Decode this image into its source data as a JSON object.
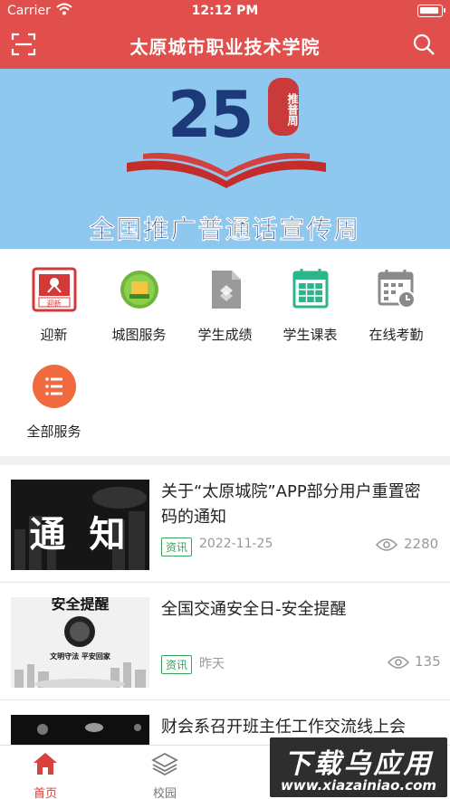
{
  "status_bar": {
    "carrier": "Carrier",
    "time": "12:12 PM"
  },
  "header": {
    "title": "太原城市职业技术学院"
  },
  "banner": {
    "number": "25",
    "seal_text": "推普周",
    "caption": "全国推广普通话宣传周"
  },
  "services": [
    {
      "label": "迎新",
      "icon": "welcome-icon",
      "badge_text": "迎新"
    },
    {
      "label": "城图服务",
      "icon": "library-icon"
    },
    {
      "label": "学生成绩",
      "icon": "grades-icon"
    },
    {
      "label": "学生课表",
      "icon": "timetable-icon"
    },
    {
      "label": "在线考勤",
      "icon": "attendance-icon"
    },
    {
      "label": "全部服务",
      "icon": "list-icon"
    }
  ],
  "news": [
    {
      "title": "关于“太原城院”APP部分用户重置密码的通知",
      "tag": "资讯",
      "date": "2022-11-25",
      "views": "2280",
      "thumb_text": "通 知"
    },
    {
      "title": "全国交通安全日-安全提醒",
      "tag": "资讯",
      "date": "昨天",
      "views": "135",
      "thumb_text_top": "安全提醒",
      "thumb_text_bottom": "文明守法 平安回家"
    },
    {
      "title": "财会系召开班主任工作交流线上会"
    }
  ],
  "tabs": [
    {
      "label": "首页",
      "active": true
    },
    {
      "label": "校园",
      "active": false
    }
  ],
  "watermark": {
    "line1": "下载乌应用",
    "line2": "www.xiazainiao.com"
  },
  "colors": {
    "brand_red": "#e04f4c",
    "tag_green": "#3aa15a",
    "banner_blue": "#8fc8ef"
  }
}
